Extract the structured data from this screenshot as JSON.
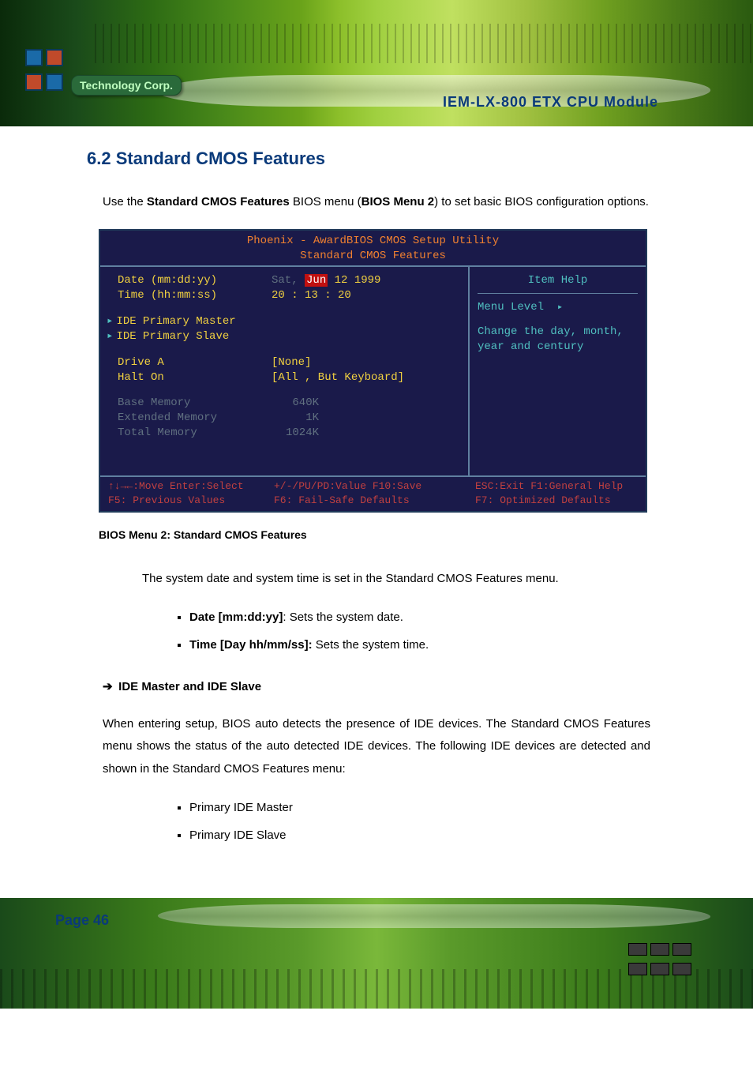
{
  "header": {
    "badge": "Technology Corp.",
    "doc_title": "IEM-LX-800  ETX  CPU  Module"
  },
  "section": {
    "number": "6.2",
    "title": "Standard CMOS Features",
    "intro_prefix": "Use the ",
    "intro_bold1": "Standard CMOS Features",
    "intro_mid": " BIOS menu (",
    "intro_bold2": "BIOS Menu 2",
    "intro_suffix": ") to set basic BIOS configuration options."
  },
  "bios": {
    "title": "Phoenix - AwardBIOS CMOS Setup Utility",
    "subtitle": "Standard CMOS Features",
    "rows": {
      "date_label": "Date (mm:dd:yy)",
      "date_val_pre": "Sat, ",
      "date_val_hl": "Jun",
      "date_val_post": " 12 1999",
      "time_label": "Time (hh:mm:ss)",
      "time_val": "20 : 13 : 20",
      "ide_master": "IDE Primary Master",
      "ide_slave": "IDE Primary Slave",
      "drive_a": "Drive A",
      "drive_a_val": "[None]",
      "halt_on": "Halt On",
      "halt_on_val": "[All , But Keyboard]",
      "base_mem": "Base Memory",
      "base_mem_val": "640K",
      "ext_mem": "Extended Memory",
      "ext_mem_val": "1K",
      "tot_mem": "Total Memory",
      "tot_mem_val": "1024K"
    },
    "right": {
      "item_help": "Item Help",
      "menu_level": "Menu Level",
      "help_line1": "Change the day, month,",
      "help_line2": "year and century"
    },
    "footer": {
      "c1a": "↑↓→←:Move  Enter:Select",
      "c1b": "F5: Previous Values",
      "c2a": "+/-/PU/PD:Value  F10:Save",
      "c2b": "F6: Fail-Safe Defaults",
      "c3a": "ESC:Exit  F1:General Help",
      "c3b": "F7: Optimized Defaults"
    }
  },
  "caption": "BIOS Menu 2: Standard CMOS Features",
  "body": {
    "p1": "The system date and system time is set in the Standard CMOS Features menu.",
    "bullets1": [
      {
        "bold": "Date [mm:dd:yy]",
        "rest": ": Sets the system date."
      },
      {
        "bold": "Time [Day hh/mm/ss]:",
        "rest": " Sets the system time."
      }
    ],
    "subhead": "IDE Master and IDE Slave",
    "p2": "When entering setup, BIOS auto detects the presence of IDE devices. The Standard CMOS Features menu shows the status of the auto detected IDE devices. The following IDE devices are detected and shown in the Standard CMOS Features menu:",
    "bullets2": [
      "Primary IDE Master",
      "Primary IDE Slave"
    ]
  },
  "footer": {
    "page": "Page 46"
  }
}
